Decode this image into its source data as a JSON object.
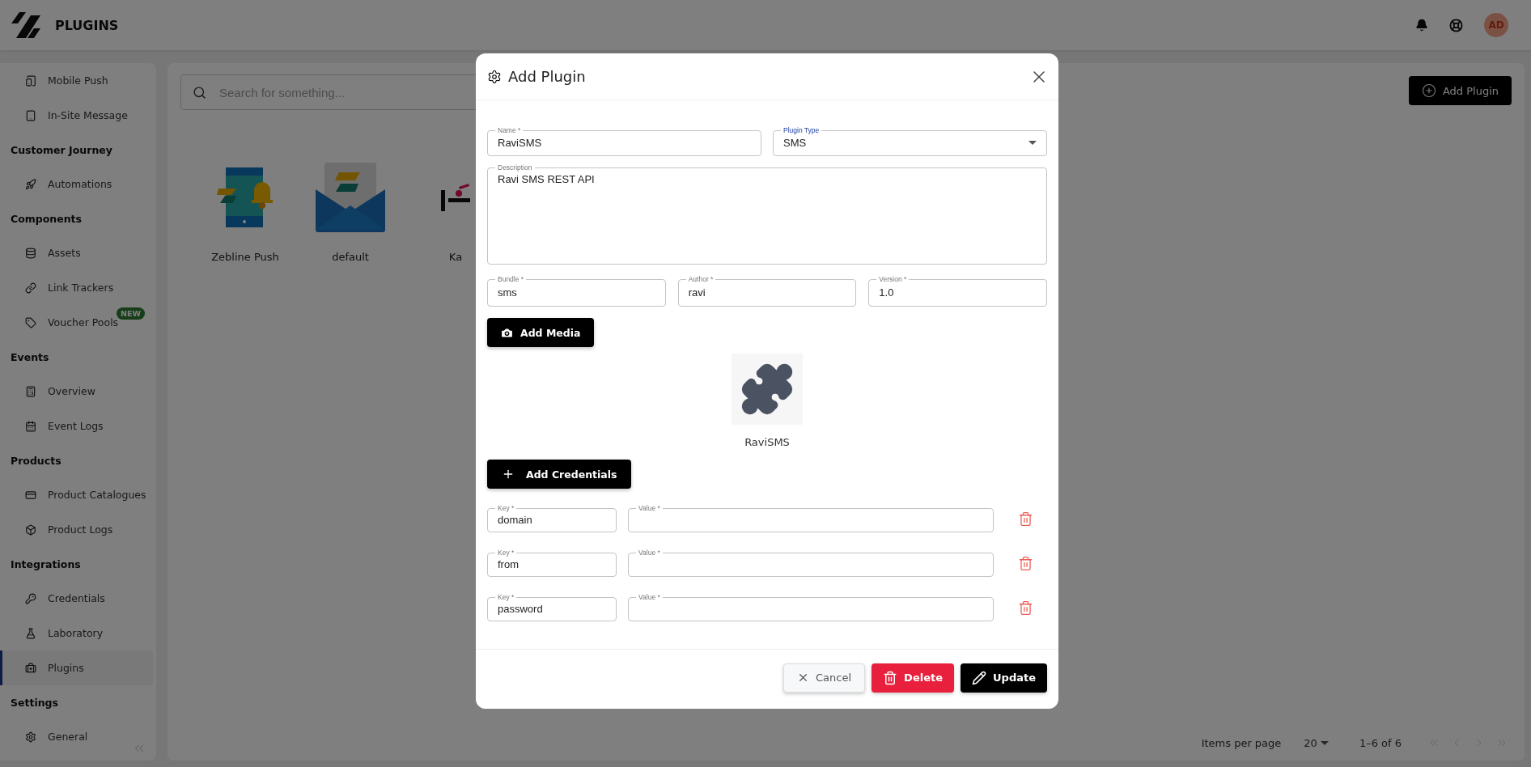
{
  "header": {
    "title": "PLUGINS",
    "avatar": "AD"
  },
  "sidebar": {
    "sections": [
      {
        "items": [
          {
            "label": "Mobile Push",
            "selected": false
          },
          {
            "label": "In-Site Message",
            "selected": false
          }
        ]
      },
      {
        "title": "Customer Journey",
        "items": [
          {
            "label": "Automations",
            "selected": false
          }
        ]
      },
      {
        "title": "Components",
        "items": [
          {
            "label": "Assets",
            "selected": false
          },
          {
            "label": "Link Trackers",
            "selected": false
          },
          {
            "label": "Voucher Pools",
            "selected": false,
            "badge": "NEW"
          }
        ]
      },
      {
        "title": "Events",
        "items": [
          {
            "label": "Overview",
            "selected": false
          },
          {
            "label": "Event Logs",
            "selected": false
          }
        ]
      },
      {
        "title": "Products",
        "items": [
          {
            "label": "Product Catalogues",
            "selected": false
          },
          {
            "label": "Product Logs",
            "selected": false
          }
        ]
      },
      {
        "title": "Integrations",
        "items": [
          {
            "label": "Credentials",
            "selected": false
          },
          {
            "label": "Laboratory",
            "selected": false
          },
          {
            "label": "Plugins",
            "selected": true
          }
        ]
      },
      {
        "title": "Settings",
        "items": [
          {
            "label": "General",
            "selected": false
          }
        ]
      }
    ]
  },
  "main": {
    "search": {
      "placeholder": "Search for something..."
    },
    "add_button": "Add Plugin",
    "plugins": [
      {
        "name": "Zebline Push",
        "kind": "phone"
      },
      {
        "name": "default",
        "kind": "envelope"
      },
      {
        "name": "Ka",
        "kind": "logo"
      }
    ],
    "pagination": {
      "items_per_page_label": "Items per page",
      "items_per_page": "20",
      "range": "1–6 of 6"
    }
  },
  "modal": {
    "title": "Add Plugin",
    "fields": [
      {
        "kind": "text",
        "label": "Name *",
        "value": "RaviSMS",
        "focused": false
      },
      {
        "kind": "select",
        "label": "Plugin Type",
        "value": "SMS",
        "focused": true
      },
      {
        "kind": "textarea",
        "label": "Description",
        "value": "Ravi SMS REST API",
        "focused": false
      },
      {
        "kind": "text",
        "label": "Bundle *",
        "value": "sms",
        "focused": false
      },
      {
        "kind": "text",
        "label": "Author *",
        "value": "ravi",
        "focused": false
      },
      {
        "kind": "text",
        "label": "Version *",
        "value": "1.0",
        "focused": false
      }
    ],
    "add_media": "Add Media",
    "media_caption": "RaviSMS",
    "add_credentials": "Add Credentials",
    "credentials": [
      {
        "key_label": "Key *",
        "key": "domain",
        "value_label": "Value *"
      },
      {
        "key_label": "Key *",
        "key": "from",
        "value_label": "Value *"
      },
      {
        "key_label": "Key *",
        "key": "password",
        "value_label": "Value *"
      }
    ],
    "buttons": [
      {
        "kind": "cancel",
        "label": "Cancel"
      },
      {
        "kind": "delete",
        "label": "Delete"
      },
      {
        "kind": "update",
        "label": "Update"
      }
    ]
  }
}
